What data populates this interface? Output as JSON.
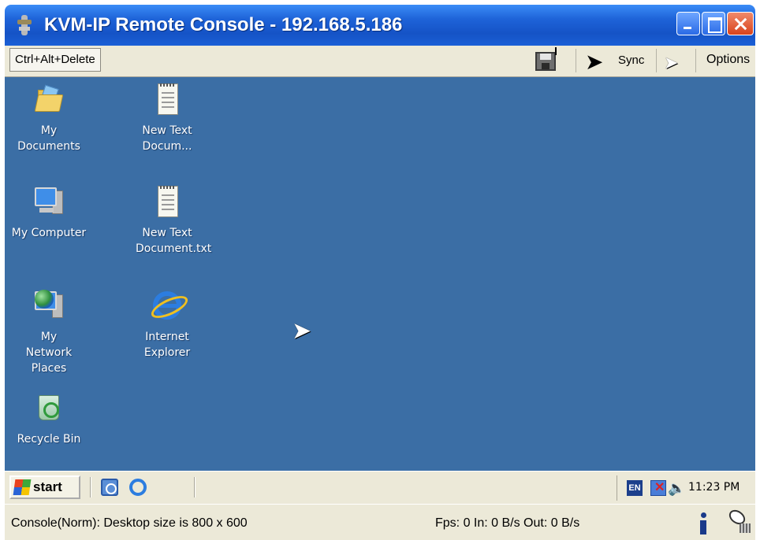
{
  "window": {
    "title": "KVM-IP  Remote Console - 192.168.5.186"
  },
  "toolbar": {
    "ctrl_alt_delete_label": "Ctrl+Alt+Delete",
    "sync_label": "Sync",
    "options_label": "Options"
  },
  "desktop": {
    "background_color": "#3b6ea5",
    "icons": [
      {
        "label": "My Documents",
        "icon": "my-documents-icon"
      },
      {
        "label": "New Text Docum...",
        "icon": "text-document-icon"
      },
      {
        "label": "My Computer",
        "icon": "my-computer-icon"
      },
      {
        "label": "New Text Document.txt",
        "icon": "text-document-icon"
      },
      {
        "label": "My Network Places",
        "icon": "network-places-icon"
      },
      {
        "label": "Internet Explorer",
        "icon": "internet-explorer-icon"
      },
      {
        "label": "Recycle Bin",
        "icon": "recycle-bin-icon"
      }
    ]
  },
  "taskbar": {
    "start_label": "start",
    "language": "EN",
    "clock": "11:23 PM"
  },
  "status": {
    "console_text": "Console(Norm): Desktop size is 800 x 600",
    "fps_text": "Fps: 0 In: 0 B/s Out: 0 B/s"
  }
}
